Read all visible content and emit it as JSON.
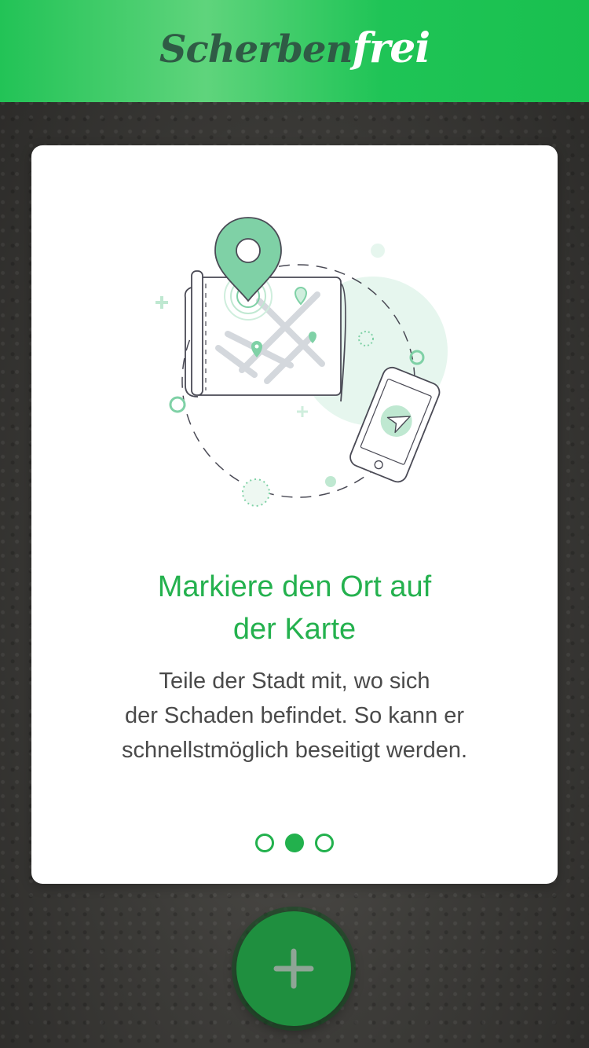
{
  "header": {
    "logo_part1": "Scherben",
    "logo_part2": "frei"
  },
  "onboarding": {
    "title": "Markiere den Ort auf\nder Karte",
    "description": "Teile der Stadt mit, wo sich\nder Schaden befindet. So kann er\nschnellstmöglich beseitigt werden.",
    "page_count": 3,
    "current_page": 2,
    "illustration": "map-with-location-pin-and-phone-navigation"
  },
  "fab": {
    "icon": "plus-icon"
  },
  "colors": {
    "header_green": "#1fc456",
    "title_green": "#24b14e",
    "fab_green": "#1f8f3f",
    "pin_green": "#7fd1a6",
    "logo_dark": "#2f5b45"
  }
}
